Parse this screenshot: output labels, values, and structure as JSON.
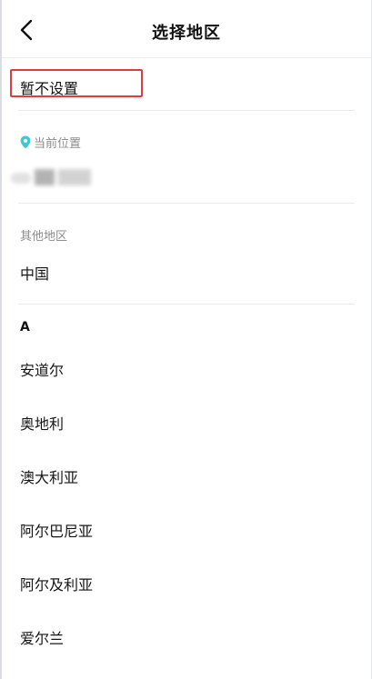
{
  "header": {
    "title": "选择地区",
    "back_icon": "chevron-left-icon"
  },
  "no_setting": {
    "label": "暂不设置",
    "highlight_color": "#e23b3b"
  },
  "current_location": {
    "label": "当前位置",
    "icon": "location-pin-icon",
    "icon_color": "#3fc7d8"
  },
  "other_regions": {
    "label": "其他地区",
    "items": [
      "中国"
    ]
  },
  "index_section": {
    "letter": "A",
    "items": [
      "安道尔",
      "奥地利",
      "澳大利亚",
      "阿尔巴尼亚",
      "阿尔及利亚",
      "爱尔兰"
    ]
  }
}
